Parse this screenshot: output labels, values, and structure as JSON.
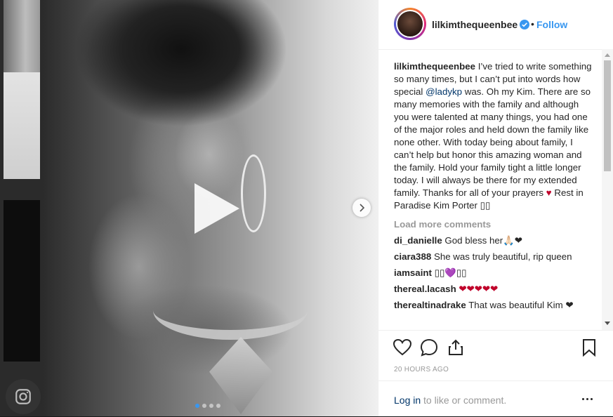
{
  "post": {
    "username": "lilkimthequeenbee",
    "separator": "•",
    "follow_label": "Follow",
    "caption_parts": {
      "text_before": " I’ve tried to write something so many times, but I can’t put into words how special ",
      "mention": "@ladykp",
      "text_after": " was. Oh my Kim. There are so many memories with the family and although you were talented at many things, you had one of the major roles and held down the family like none other. With today being about family, I can’t help but honor this amazing woman and the family. Hold your family tight a little longer today. I will always be there for my extended family. Thanks for all of your prayers ",
      "heart": "♥",
      "text_end": " Rest in Paradise Kim Porter ▯▯"
    },
    "load_more_label": "Load more comments",
    "comments": [
      {
        "user": "di_danielle",
        "text": " God bless her🙏🏻❤"
      },
      {
        "user": "ciara388",
        "text": " She was truly beautiful, rip queen"
      },
      {
        "user": "iamsaint",
        "text": " ▯▯💜▯▯"
      },
      {
        "user": "thereal.lacash",
        "text": " ❤❤❤❤❤"
      },
      {
        "user": "therealtinadrake",
        "text": " That was beautiful Kim ❤"
      }
    ],
    "timestamp": "20 HOURS AGO",
    "login_link": "Log in",
    "login_rest": " to like or comment."
  },
  "media": {
    "carousel_dots": 4,
    "active_dot": 0
  },
  "colors": {
    "accent": "#3897f0",
    "heart": "#c0002a",
    "mention": "#003569"
  }
}
